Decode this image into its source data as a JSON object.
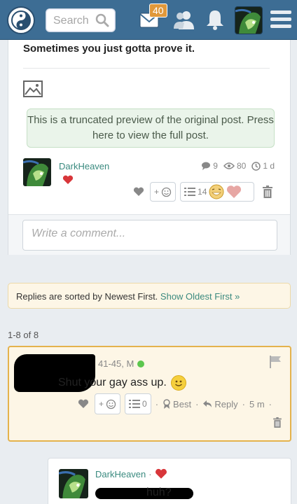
{
  "topbar": {
    "search_placeholder": "Search",
    "mail_count": "40"
  },
  "post": {
    "title": "Sometimes you just gotta prove it.",
    "truncated_notice": "This is a truncated preview of the original post. Press here to view the full post.",
    "author": "DarkHeaven",
    "comments_count": "9",
    "views_count": "80",
    "age": "1 d",
    "add_reaction_label": "+",
    "list_count": "14",
    "comment_placeholder": "Write a comment..."
  },
  "sort": {
    "text": "Replies are sorted by Newest First.",
    "link": "Show Oldest First »"
  },
  "replies_count": "1-8 of 8",
  "reply1": {
    "meta": "41-45, M",
    "text": "Shut your gay ass up.",
    "add_reaction_label": "+",
    "list_count": "0",
    "best_label": "Best",
    "reply_label": "Reply",
    "age": "5 m",
    "sep": "·"
  },
  "reply2": {
    "author": "DarkHeaven",
    "sep": "·",
    "text": "huh?"
  },
  "colors": {
    "topbar": "#3d6d94",
    "accent_teal": "#3a8a7f",
    "highlight_border": "#e4b24c",
    "badge": "#e0983a"
  }
}
